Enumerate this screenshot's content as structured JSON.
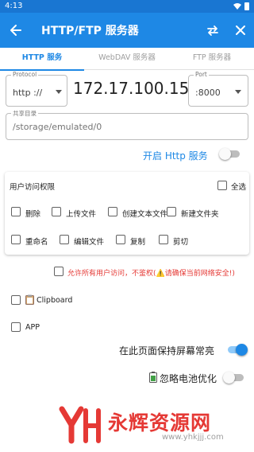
{
  "status_bar": {
    "time": "4:13"
  },
  "app_bar": {
    "title": "HTTP/FTP 服务器"
  },
  "tabs": [
    {
      "label": "HTTP 服务",
      "active": true
    },
    {
      "label": "WebDAV 服务器",
      "active": false
    },
    {
      "label": "FTP 服务器",
      "active": false
    }
  ],
  "server": {
    "protocol_legend": "Protocol",
    "protocol_value": "http ://",
    "ip_address": "172.17.100.15",
    "port_legend": "Port",
    "port_value": ":8000",
    "share_dir_legend": "共享目录",
    "share_dir_value": "/storage/emulated/0",
    "enable_label": "开启 Http 服务",
    "enabled": false
  },
  "permissions": {
    "title": "用户访问权限",
    "select_all": "全选",
    "items": [
      "删除",
      "上传文件",
      "创建文本文件",
      "新建文件夹",
      "重命名",
      "编辑文件",
      "复制",
      "剪切"
    ]
  },
  "allow_all_warning": "允许所有用户访问，不鉴权(⚠️请确保当前网络安全!)",
  "clipboard_label": "Clipboard",
  "app_label": "APP",
  "keep_screen_on_label": "在此页面保持屏幕常亮",
  "keep_screen_on": true,
  "ignore_battery_label": "忽略电池优化",
  "ignore_battery": false,
  "watermark": {
    "name": "永辉资源网",
    "url": "www.yhkjjj.com"
  },
  "colors": {
    "primary": "#1e88e5",
    "warning": "#e53935"
  }
}
